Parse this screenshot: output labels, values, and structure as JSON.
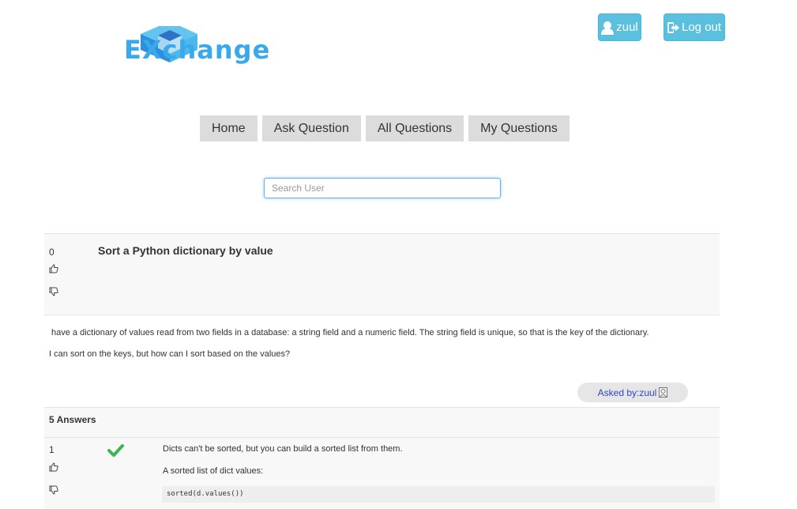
{
  "header": {
    "logo_text": "EXchange",
    "user_label": "zuul",
    "logout_label": "Log out",
    "accent_color": "#5bc0de"
  },
  "nav": {
    "items": [
      "Home",
      "Ask Question",
      "All Questions",
      "My Questions"
    ]
  },
  "search": {
    "placeholder": "Search User",
    "value": ""
  },
  "question": {
    "votes": "0",
    "title": "Sort a Python dictionary by value",
    "body_1": "have a dictionary of values read from two fields in a database: a string field and a numeric field. The string field is unique, so that is the key of the dictionary.",
    "body_2": "I can sort on the keys, but how can I sort based on the values?",
    "asked_by": "Asked by:zuul"
  },
  "answers": {
    "count_label": "5 Answers",
    "items": [
      {
        "votes": "1",
        "accepted": true,
        "text_1": "Dicts can't be sorted, but you can build a sorted list from them.",
        "text_2": "A sorted list of dict values:",
        "code": "sorted(d.values())"
      }
    ]
  }
}
